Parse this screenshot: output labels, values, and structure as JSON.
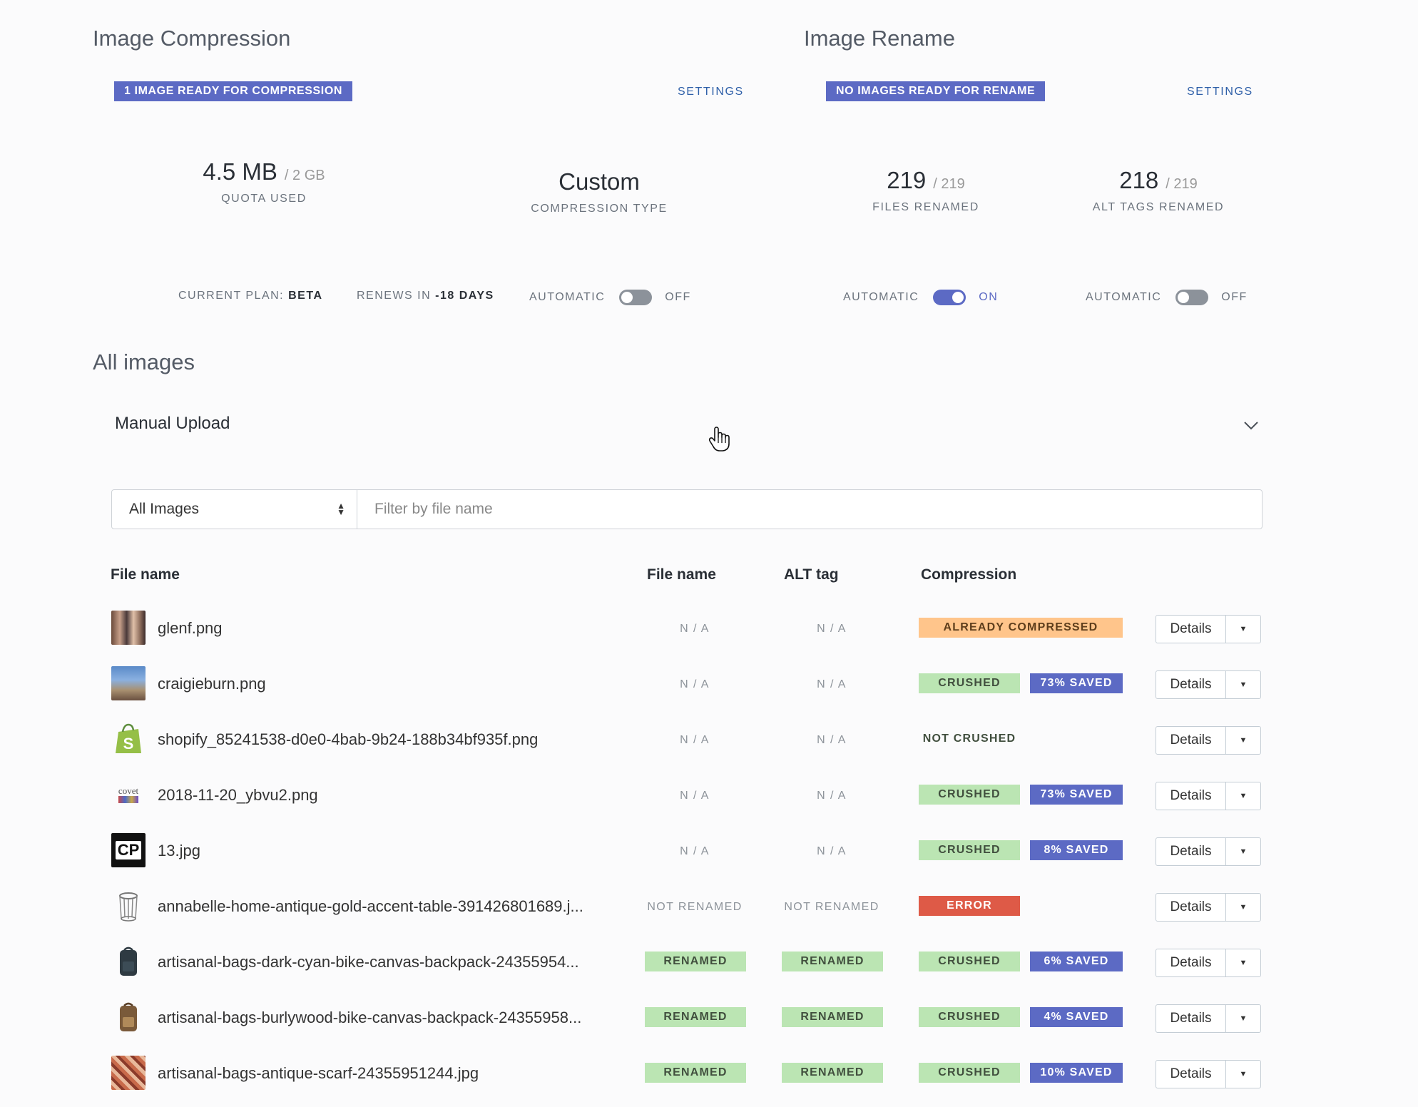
{
  "compression": {
    "title": "Image Compression",
    "badge": "1 IMAGE READY FOR COMPRESSION",
    "settings": "SETTINGS",
    "quota_value": "4.5 MB",
    "quota_total": "/ 2 GB",
    "quota_label": "QUOTA USED",
    "type_value": "Custom",
    "type_label": "COMPRESSION TYPE",
    "plan_label": "CURRENT PLAN:",
    "plan_value": "BETA",
    "renews_label": "RENEWS IN",
    "renews_value": "-18 DAYS",
    "automatic_label": "AUTOMATIC",
    "automatic_state": "OFF"
  },
  "rename": {
    "title": "Image Rename",
    "badge": "NO IMAGES READY FOR RENAME",
    "settings": "SETTINGS",
    "files_value": "219",
    "files_total": "/ 219",
    "files_label": "FILES RENAMED",
    "alt_value": "218",
    "alt_total": "/ 219",
    "alt_label": "ALT TAGS RENAMED",
    "files_automatic_label": "AUTOMATIC",
    "files_automatic_state": "ON",
    "alt_automatic_label": "AUTOMATIC",
    "alt_automatic_state": "OFF"
  },
  "all_images": {
    "title": "All images",
    "accordion_title": "Manual Upload",
    "select_value": "All Images",
    "filter_placeholder": "Filter by file name"
  },
  "table": {
    "headers": [
      "File name",
      "File name",
      "ALT tag",
      "Compression"
    ],
    "details_label": "Details",
    "rows": [
      {
        "file": "glenf.png",
        "fn_status": "N / A",
        "alt_status": "N / A",
        "compression": "ALREADY COMPRESSED",
        "saved": ""
      },
      {
        "file": "craigieburn.png",
        "fn_status": "N / A",
        "alt_status": "N / A",
        "compression": "CRUSHED",
        "saved": "73% SAVED"
      },
      {
        "file": "shopify_85241538-d0e0-4bab-9b24-188b34bf935f.png",
        "fn_status": "N / A",
        "alt_status": "N / A",
        "compression": "NOT CRUSHED",
        "saved": ""
      },
      {
        "file": "2018-11-20_ybvu2.png",
        "fn_status": "N / A",
        "alt_status": "N / A",
        "compression": "CRUSHED",
        "saved": "73% SAVED"
      },
      {
        "file": "13.jpg",
        "fn_status": "N / A",
        "alt_status": "N / A",
        "compression": "CRUSHED",
        "saved": "8% SAVED"
      },
      {
        "file": "annabelle-home-antique-gold-accent-table-391426801689.j...",
        "fn_status": "NOT RENAMED",
        "alt_status": "NOT RENAMED",
        "compression": "ERROR",
        "saved": ""
      },
      {
        "file": "artisanal-bags-dark-cyan-bike-canvas-backpack-24355954...",
        "fn_status": "RENAMED",
        "alt_status": "RENAMED",
        "compression": "CRUSHED",
        "saved": "6% SAVED"
      },
      {
        "file": "artisanal-bags-burlywood-bike-canvas-backpack-24355958...",
        "fn_status": "RENAMED",
        "alt_status": "RENAMED",
        "compression": "CRUSHED",
        "saved": "4% SAVED"
      },
      {
        "file": "artisanal-bags-antique-scarf-24355951244.jpg",
        "fn_status": "RENAMED",
        "alt_status": "RENAMED",
        "compression": "CRUSHED",
        "saved": "10% SAVED"
      }
    ]
  },
  "thumb_icons": {
    "shopify_letter": "S",
    "covet_text": "covet",
    "cp_text": "CP"
  },
  "colors": {
    "accent": "#5c6ac4",
    "green": "#bbe5b3",
    "orange": "#ffc58b",
    "red": "#de5a47"
  }
}
